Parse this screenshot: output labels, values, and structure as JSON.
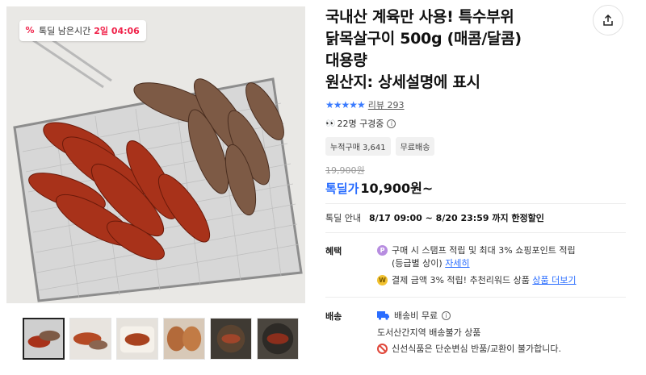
{
  "gallery": {
    "timer_badge": {
      "label": "톡딜 남은시간",
      "time": "2일 04:06"
    },
    "thumbnail_count": 6,
    "active_thumbnail": 1
  },
  "product": {
    "title_lines": [
      "국내산 계육만 사용! 특수부위",
      "닭목살구이 500g (매콤/달콤)",
      "대용량",
      "원산지: 상세설명에 표시"
    ],
    "rating_stars": "★★★★★",
    "review_text": "리뷰 293",
    "viewers_text": "22명 구경중",
    "tags": [
      "누적구매 3,641",
      "무료배송"
    ],
    "original_price": "19,900원",
    "price_label": "톡딜가",
    "price_value": "10,900원~"
  },
  "deal": {
    "label": "톡딜 안내",
    "period": "8/17 09:00 ~ 8/20 23:59 까지 한정할인"
  },
  "benefits": {
    "label": "혜택",
    "item1_icon": "P",
    "item1_line1": "구매 시 스탬프 적립 및 최대 3% 쇼핑포인트 적립",
    "item1_line2": "(등급별 상이)",
    "item1_link": "자세히",
    "item2_icon": "W",
    "item2_text": "결제 금액 3% 적립! 추천리워드 상품",
    "item2_link": "상품 더보기"
  },
  "shipping": {
    "label": "배송",
    "fee": "배송비 무료",
    "area": "도서산간지역 배송불가 상품",
    "notice": "신선식품은 단순변심 반품/교환이 불가합니다."
  },
  "colors": {
    "accent_blue": "#2a6dff",
    "timer_red": "#f0224a",
    "notice_red": "#e0483b"
  }
}
